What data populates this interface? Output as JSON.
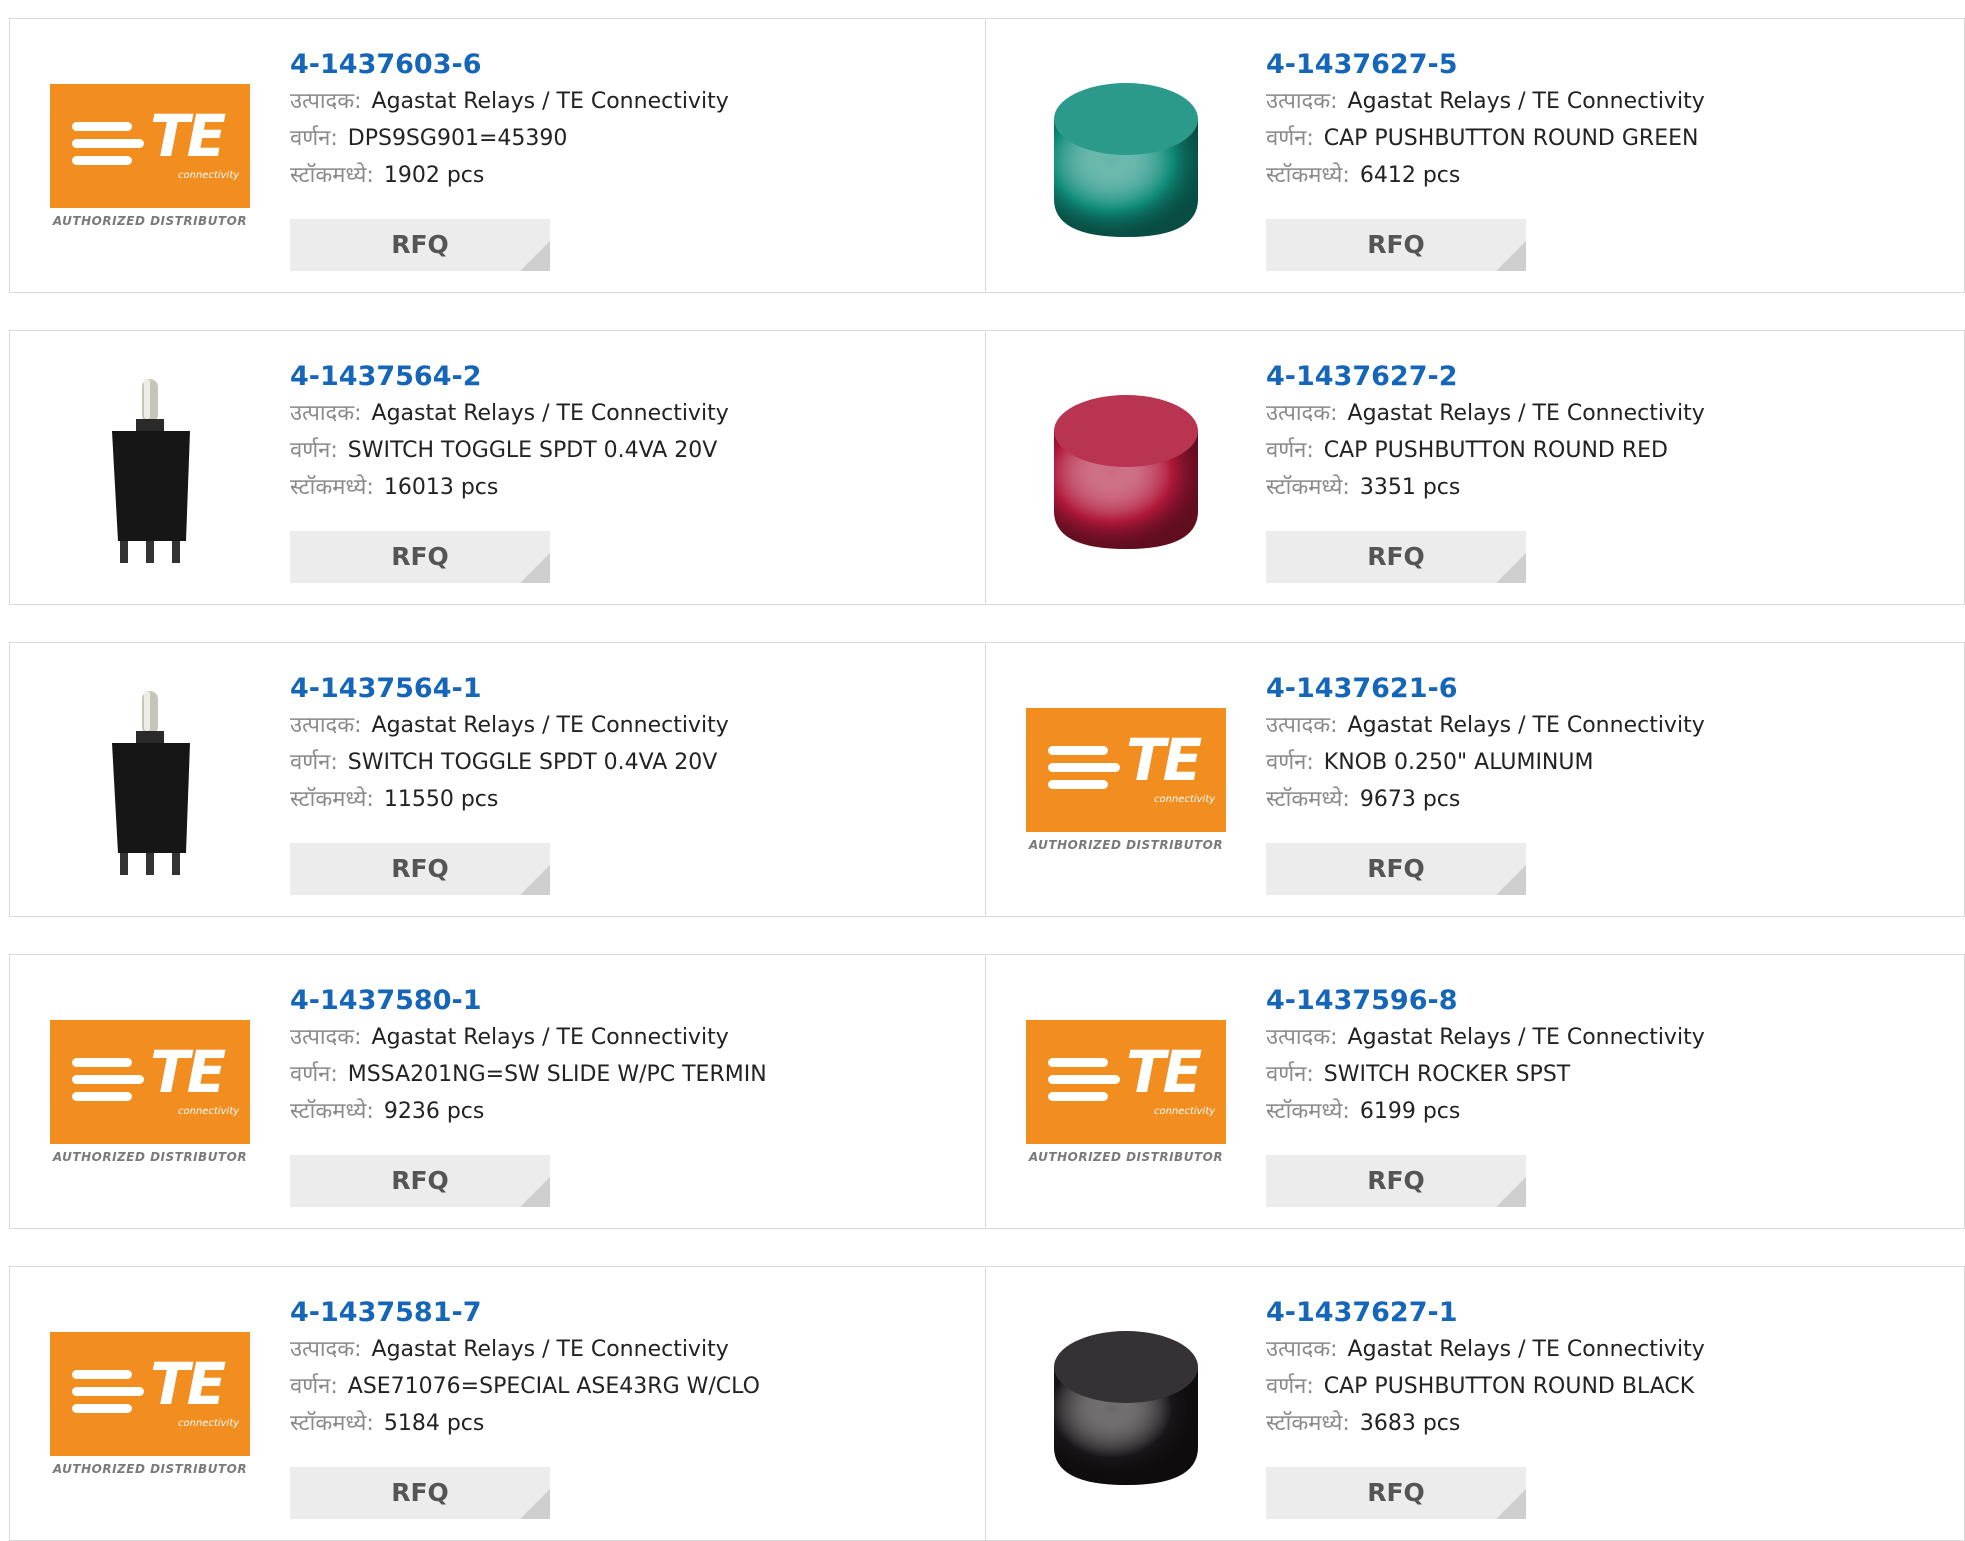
{
  "labels": {
    "manufacturer": "उत्पादक:",
    "description": "वर्णन:",
    "stock": "स्टॉकमध्ये:",
    "rfq": "RFQ"
  },
  "logo": {
    "brand": "TE",
    "sub": "connectivity",
    "caption": "AUTHORIZED DISTRIBUTOR"
  },
  "products": [
    {
      "part": "4-1437603-6",
      "manufacturer": "Agastat Relays / TE Connectivity",
      "description": "DPS9SG901=45390",
      "stock": "1902 pcs",
      "image": "te-logo"
    },
    {
      "part": "4-1437627-5",
      "manufacturer": "Agastat Relays / TE Connectivity",
      "description": "CAP PUSHBUTTON ROUND GREEN",
      "stock": "6412 pcs",
      "image": "cap-green",
      "color": "#0f8c7a"
    },
    {
      "part": "4-1437564-2",
      "manufacturer": "Agastat Relays / TE Connectivity",
      "description": "SWITCH TOGGLE SPDT 0.4VA 20V",
      "stock": "16013 pcs",
      "image": "toggle-switch"
    },
    {
      "part": "4-1437627-2",
      "manufacturer": "Agastat Relays / TE Connectivity",
      "description": "CAP PUSHBUTTON ROUND RED",
      "stock": "3351 pcs",
      "image": "cap-red",
      "color": "#b0183a"
    },
    {
      "part": "4-1437564-1",
      "manufacturer": "Agastat Relays / TE Connectivity",
      "description": "SWITCH TOGGLE SPDT 0.4VA 20V",
      "stock": "11550 pcs",
      "image": "toggle-switch"
    },
    {
      "part": "4-1437621-6",
      "manufacturer": "Agastat Relays / TE Connectivity",
      "description": "KNOB 0.250\" ALUMINUM",
      "stock": "9673 pcs",
      "image": "te-logo"
    },
    {
      "part": "4-1437580-1",
      "manufacturer": "Agastat Relays / TE Connectivity",
      "description": "MSSA201NG=SW SLIDE W/PC TERMIN",
      "stock": "9236 pcs",
      "image": "te-logo"
    },
    {
      "part": "4-1437596-8",
      "manufacturer": "Agastat Relays / TE Connectivity",
      "description": "SWITCH ROCKER SPST",
      "stock": "6199 pcs",
      "image": "te-logo"
    },
    {
      "part": "4-1437581-7",
      "manufacturer": "Agastat Relays / TE Connectivity",
      "description": "ASE71076=SPECIAL ASE43RG W/CLO",
      "stock": "5184 pcs",
      "image": "te-logo"
    },
    {
      "part": "4-1437627-1",
      "manufacturer": "Agastat Relays / TE Connectivity",
      "description": "CAP PUSHBUTTON ROUND BLACK",
      "stock": "3683 pcs",
      "image": "cap-black",
      "color": "#1a1518"
    }
  ]
}
